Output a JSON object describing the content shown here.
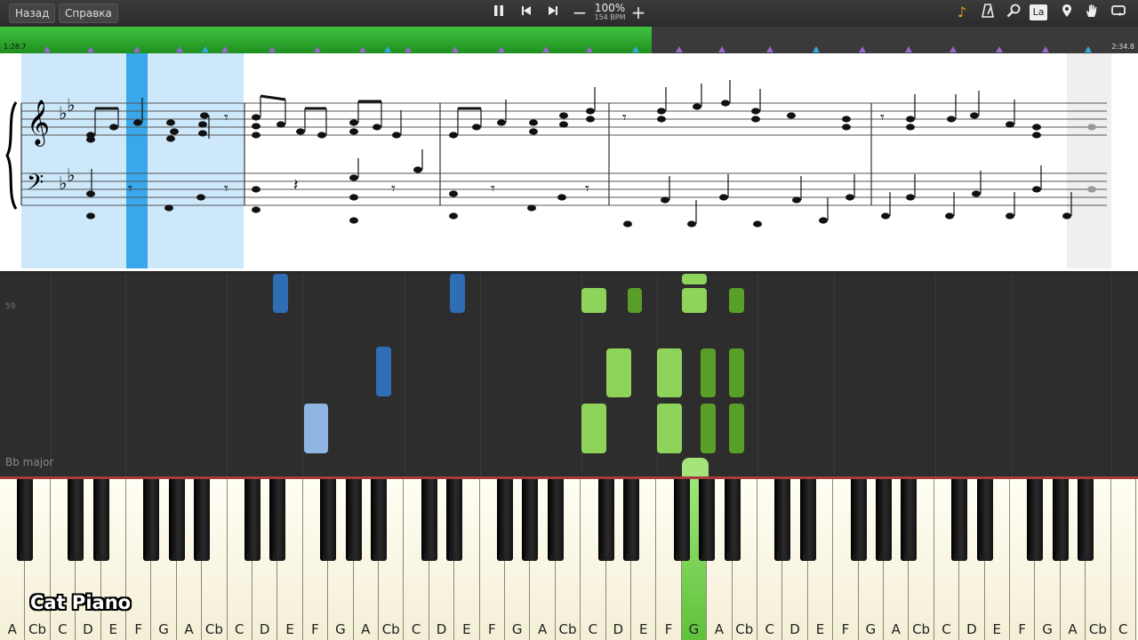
{
  "toolbar": {
    "back_label": "Назад",
    "help_label": "Справка",
    "tempo_percent": "100%",
    "tempo_bpm": "154 BPM",
    "lang_label": "La"
  },
  "timeline": {
    "current_time": "1:28.7",
    "total_time": "2:34.8",
    "played_fraction": 0.573
  },
  "piano_roll": {
    "pitch_label": "59",
    "key_label": "Bb major"
  },
  "keyboard": {
    "white_keys": [
      "A",
      "Cb",
      "C",
      "D",
      "E",
      "F",
      "G",
      "A",
      "Cb",
      "C",
      "D",
      "E",
      "F",
      "G",
      "A",
      "Cb",
      "C",
      "D",
      "E",
      "F",
      "G",
      "A",
      "Cb",
      "C",
      "D",
      "E",
      "F",
      "G",
      "A",
      "Cb",
      "C",
      "D",
      "E",
      "F",
      "G",
      "A",
      "Cb",
      "C",
      "D",
      "E",
      "F",
      "G",
      "A",
      "Cb",
      "C"
    ],
    "black_keys": [
      "Bb",
      "Db",
      "Eb",
      "Gb",
      "Ab",
      "Bb",
      "Db",
      "Eb",
      "Gb",
      "Ab",
      "Bb",
      "Db",
      "Eb",
      "Gb",
      "Ab",
      "Bb",
      "Db",
      "Eb",
      "Gb",
      "Ab",
      "Bb",
      "Db",
      "Eb",
      "Gb",
      "Ab",
      "Bb",
      "Db",
      "Eb",
      "Gb",
      "Ab",
      "Bb",
      "Db"
    ],
    "active_key": "G"
  },
  "logo": "Cat Piano",
  "colors": {
    "progress_green": "#2fb32f",
    "left_hand": "#2f6db5",
    "right_hand_played": "#8fd45a",
    "highlight": "#cde8fa"
  }
}
